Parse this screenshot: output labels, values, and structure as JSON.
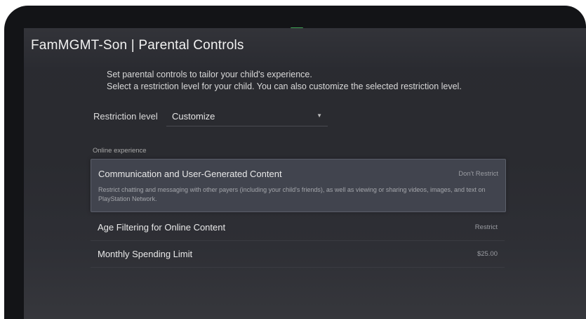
{
  "header": {
    "title": "FamMGMT-Son | Parental Controls"
  },
  "description": {
    "line1": "Set parental controls to tailor your child's experience.",
    "line2": "Select a restriction level for your child. You can also customize the selected restriction level."
  },
  "restriction": {
    "label": "Restriction level",
    "value": "Customize"
  },
  "online": {
    "section_label": "Online experience",
    "items": [
      {
        "name": "Communication and User-Generated Content",
        "status": "Don't Restrict",
        "description": "Restrict chatting and messaging with other payers (including your child's friends), as well as viewing or sharing videos, images, and text on PlayStation Network."
      },
      {
        "name": "Age Filtering for Online Content",
        "status": "Restrict"
      },
      {
        "name": "Monthly Spending Limit",
        "status": "$25.00"
      }
    ]
  },
  "colors": {
    "background": "#2a2b30",
    "highlight": "#424650",
    "led": "#4fd36a"
  }
}
